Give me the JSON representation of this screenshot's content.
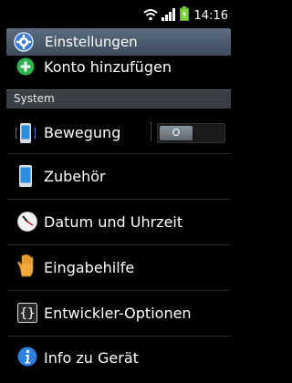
{
  "status_bar": {
    "time": "14:16",
    "icons": [
      "wifi-icon",
      "signal-icon",
      "battery-icon"
    ]
  },
  "action_bar": {
    "title": "Einstellungen",
    "icon": "gear-icon"
  },
  "top_item": {
    "label": "Konto hinzufügen",
    "icon": "plus-circle-icon"
  },
  "section_header": {
    "label": "System"
  },
  "items": [
    {
      "label": "Bewegung",
      "icon": "phone-motion-icon",
      "toggle_state": "O"
    },
    {
      "label": "Zubehör",
      "icon": "phone-device-icon"
    },
    {
      "label": "Datum und Uhrzeit",
      "icon": "clock-icon"
    },
    {
      "label": "Eingabehilfe",
      "icon": "hand-icon"
    },
    {
      "label": "Entwickler-Optionen",
      "icon": "braces-icon"
    },
    {
      "label": "Info zu Gerät",
      "icon": "info-icon"
    }
  ],
  "colors": {
    "accent_blue": "#3a7bd5",
    "plus_green": "#2bb24c",
    "section_bg": "#3a3f45",
    "action_bar_bg": "#4b5a6b"
  }
}
